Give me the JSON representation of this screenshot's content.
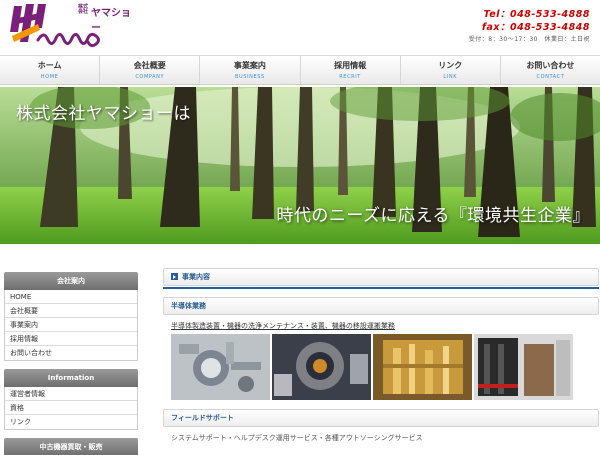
{
  "header": {
    "logo_small": "株式\n会社",
    "logo_name": "ヤマショー",
    "logo_script": "Yamasyo",
    "tel": "Tel：048-533-4888",
    "fax": "fax：048-533-4848",
    "hours": "受付：8：30〜17：30　休業日：土日祝"
  },
  "nav": [
    {
      "jp": "ホーム",
      "en": "HOME"
    },
    {
      "jp": "会社概要",
      "en": "COMPANY"
    },
    {
      "jp": "事業案内",
      "en": "BUSINESS"
    },
    {
      "jp": "採用情報",
      "en": "RECRIT"
    },
    {
      "jp": "リンク",
      "en": "LINK"
    },
    {
      "jp": "お問い合わせ",
      "en": "CONTACT"
    }
  ],
  "hero": {
    "title": "株式会社ヤマショーは",
    "subtitle": "時代のニーズに応える『環境共生企業』"
  },
  "sidebar": {
    "company": {
      "title": "会社案内",
      "items": [
        "HOME",
        "会社概要",
        "事業案内",
        "採用情報",
        "お問い合わせ"
      ]
    },
    "information": {
      "title": "Information",
      "items": [
        "運営者情報",
        "資格",
        "リンク"
      ]
    },
    "used": {
      "title": "中古機器買取・販売"
    }
  },
  "main": {
    "section_title": "事業内容",
    "sub1_title": "半導体業務",
    "sub1_link": "半導体製造装置・機器の洗浄メンテナンス・装置、機器の移設運搬業務",
    "sub2_title": "フィールドサポート",
    "sub2_text": "システムサポート・ヘルプデスク運用サービス・各種アウトソーシングサービス"
  },
  "colors": {
    "brand_purple": "#7a1f7a",
    "tel_red": "#cc0000",
    "accent_blue": "#2a5d91",
    "nav_en_blue": "#3a8fd6"
  }
}
